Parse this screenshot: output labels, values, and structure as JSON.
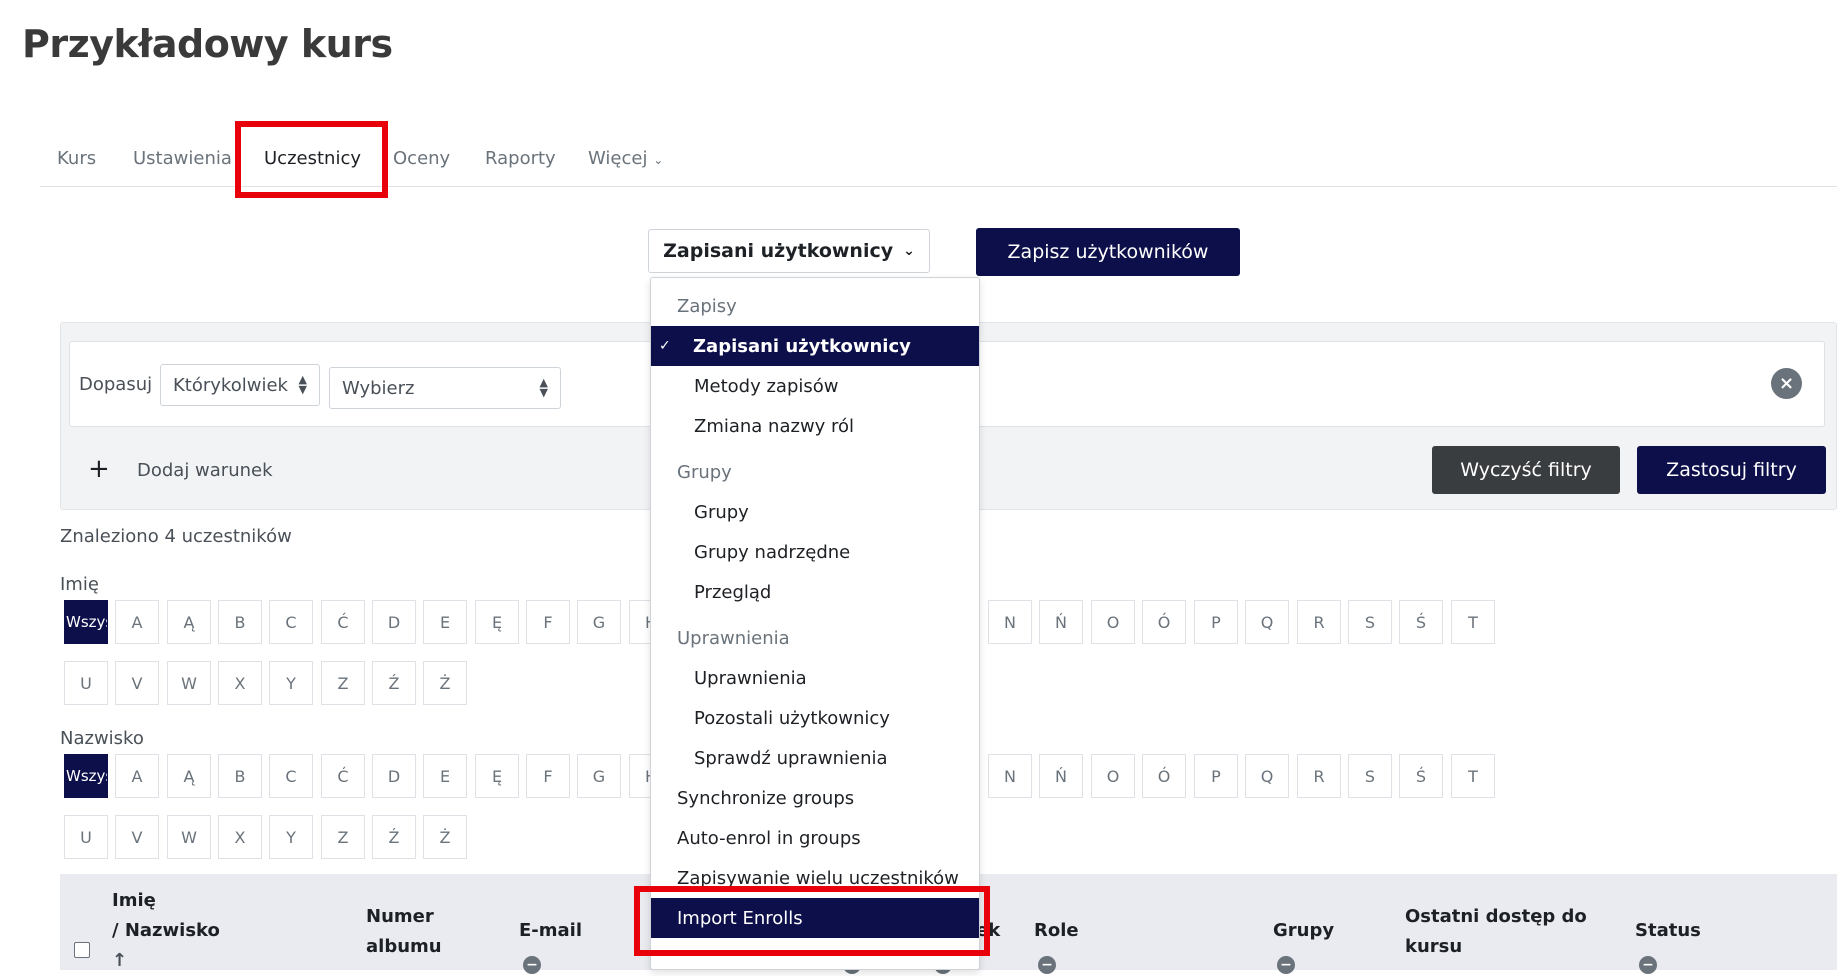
{
  "page_title": "Przykładowy kurs",
  "tabs": [
    {
      "label": "Kurs"
    },
    {
      "label": "Ustawienia"
    },
    {
      "label": "Uczestnicy"
    },
    {
      "label": "Oceny"
    },
    {
      "label": "Raporty"
    },
    {
      "label": "Więcej"
    }
  ],
  "enrol_select": {
    "value": "Zapisani użytkownicy"
  },
  "enrol_button": "Zapisz użytkowników",
  "filter": {
    "match_label": "Dopasuj",
    "match_value": "Którykolwiek",
    "type_value": "Wybierz",
    "add_condition": "Dodaj warunek",
    "clear_button": "Wyczyść filtry",
    "apply_button": "Zastosuj filtry"
  },
  "found_text": "Znaleziono 4 uczestników",
  "initials": {
    "first_name_label": "Imię",
    "last_name_label": "Nazwisko",
    "all_label": "Wszystkie",
    "row1_left": [
      "A",
      "Ą",
      "B",
      "C",
      "Ć",
      "D",
      "E",
      "Ę",
      "F",
      "G",
      "H"
    ],
    "row1_right": [
      "N",
      "Ń",
      "O",
      "Ó",
      "P",
      "Q",
      "R",
      "S",
      "Ś",
      "T"
    ],
    "row2": [
      "U",
      "V",
      "W",
      "X",
      "Y",
      "Z",
      "Ź",
      "Ż"
    ]
  },
  "table_headers": {
    "name_first": "Imię",
    "name_last": "/ Nazwisko",
    "sort_icon": "↑",
    "album_1": "Numer",
    "album_2": "albumu",
    "email": "E-mail",
    "partial": "ek",
    "roles": "Role",
    "groups": "Grupy",
    "last_access_1": "Ostatni dostęp do",
    "last_access_2": "kursu",
    "status": "Status"
  },
  "dropdown": {
    "items": [
      {
        "label": "Zapisy",
        "kind": "header"
      },
      {
        "label": "Zapisani użytkownicy",
        "kind": "active"
      },
      {
        "label": "Metody zapisów",
        "kind": "item"
      },
      {
        "label": "Zmiana nazwy ról",
        "kind": "item"
      },
      {
        "label": "Grupy",
        "kind": "header"
      },
      {
        "label": "Grupy",
        "kind": "item"
      },
      {
        "label": "Grupy nadrzędne",
        "kind": "item"
      },
      {
        "label": "Przegląd",
        "kind": "item"
      },
      {
        "label": "Uprawnienia",
        "kind": "header"
      },
      {
        "label": "Uprawnienia",
        "kind": "item"
      },
      {
        "label": "Pozostali użytkownicy",
        "kind": "item"
      },
      {
        "label": "Sprawdź uprawnienia",
        "kind": "item"
      },
      {
        "label": "Synchronize groups",
        "kind": "plain"
      },
      {
        "label": "Auto-enrol in groups",
        "kind": "plain"
      },
      {
        "label": "Zapisywanie wielu uczestników",
        "kind": "plain"
      },
      {
        "label": "Import Enrolls",
        "kind": "highlight"
      }
    ]
  },
  "colors": {
    "accent": "#0d0f4a",
    "highlight_border": "#e8000b",
    "dark_button": "#3a3d40"
  }
}
